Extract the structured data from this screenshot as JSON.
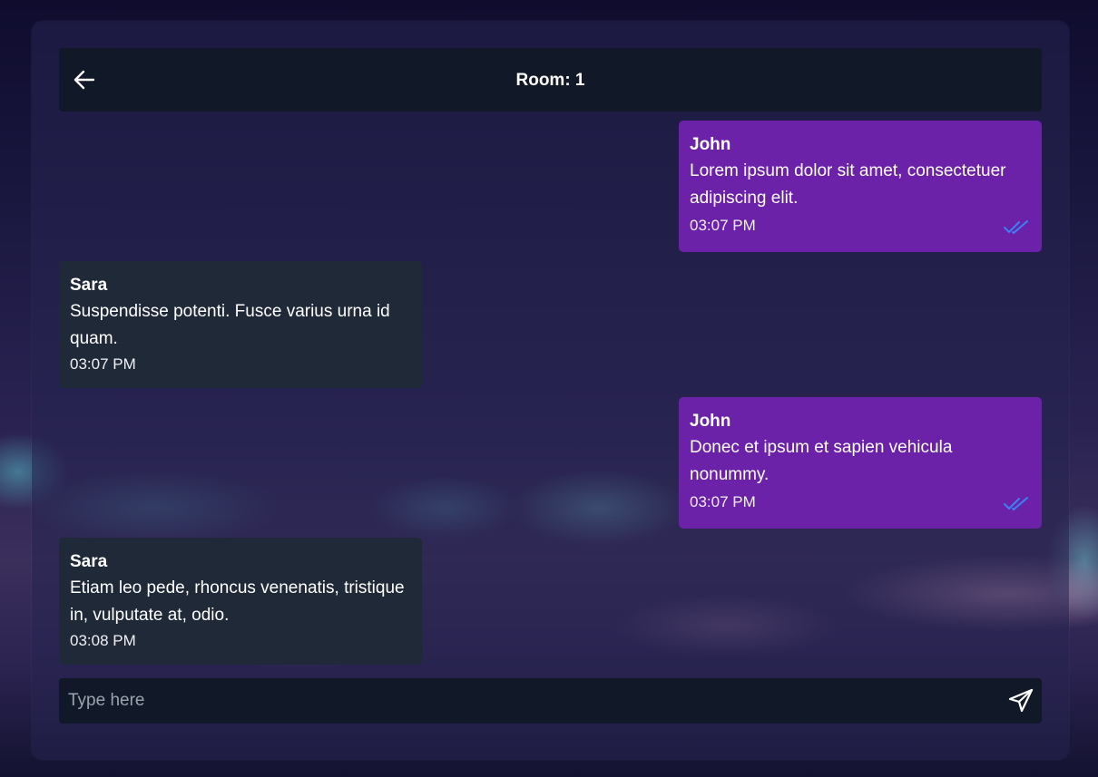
{
  "header": {
    "title": "Room: 1",
    "back_icon": "arrow-left-icon"
  },
  "messages": [
    {
      "sender": "John",
      "text": "Lorem ipsum dolor sit amet, consectetuer adipiscing elit.",
      "time": "03:07 PM",
      "own": true,
      "read_icon": "double-check-icon"
    },
    {
      "sender": "Sara",
      "text": "Suspendisse potenti. Fusce varius urna id quam.",
      "time": "03:07 PM",
      "own": false
    },
    {
      "sender": "John",
      "text": "Donec et ipsum et sapien vehicula nonummy.",
      "time": "03:07 PM",
      "own": true,
      "read_icon": "double-check-icon"
    },
    {
      "sender": "Sara",
      "text": "Etiam leo pede, rhoncus venenatis, tristique in, vulputate at, odio.",
      "time": "03:08 PM",
      "own": false
    }
  ],
  "composer": {
    "placeholder": "Type here",
    "value": "",
    "send_icon": "send-icon"
  },
  "colors": {
    "own_bubble": "#6b21a8",
    "other_bubble": "#1f2937",
    "bar": "#111827",
    "read_check": "#3b82f6",
    "placeholder": "#9ca3af"
  }
}
